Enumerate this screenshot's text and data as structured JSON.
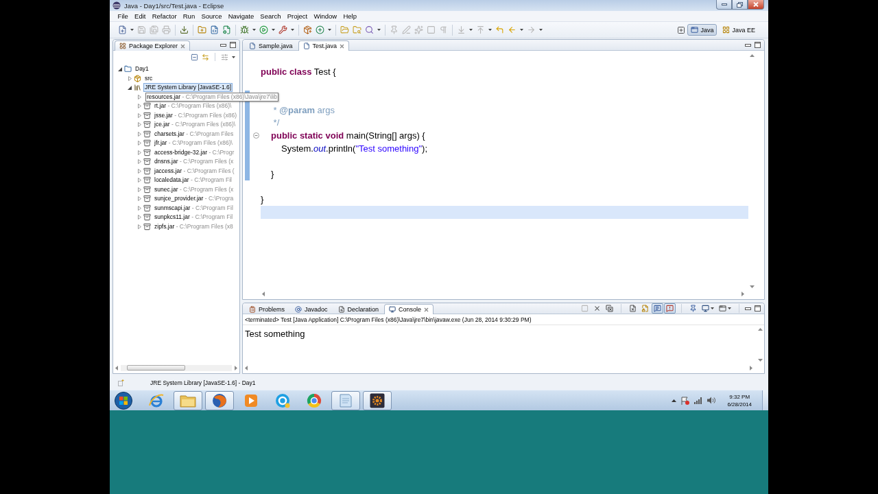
{
  "window": {
    "title": "Java - Day1/src/Test.java - Eclipse"
  },
  "menu_bar": [
    "File",
    "Edit",
    "Refactor",
    "Run",
    "Source",
    "Navigate",
    "Search",
    "Project",
    "Window",
    "Help"
  ],
  "toolbar": {
    "groups": [
      [
        {
          "disabled": false
        },
        {
          "disabled": true
        },
        {
          "disabled": true
        },
        {
          "disabled": true
        }
      ],
      [
        {
          "disabled": false
        }
      ],
      [
        {
          "disabled": false
        },
        {
          "disabled": false
        },
        {
          "disabled": false
        }
      ],
      [
        {
          "disabled": false
        },
        {
          "disabled": false
        },
        {
          "disabled": false
        }
      ],
      [
        {
          "disabled": false
        },
        {
          "disabled": false
        }
      ],
      [
        {
          "disabled": false
        },
        {
          "disabled": false
        },
        {
          "disabled": false
        }
      ],
      [
        {
          "disabled": true
        },
        {
          "disabled": true
        },
        {
          "disabled": true
        },
        {
          "disabled": true
        },
        {
          "disabled": true
        }
      ],
      [
        {
          "disabled": true
        },
        {
          "disabled": true
        },
        {
          "disabled": false
        },
        {
          "disabled": false
        },
        {
          "disabled": true
        }
      ]
    ]
  },
  "perspectives": [
    {
      "label": "Java",
      "selected": true
    },
    {
      "label": "Java EE",
      "selected": false
    }
  ],
  "package_explorer": {
    "title": "Package Explorer",
    "tree": [
      {
        "label": "Day1",
        "kind": "project",
        "expanded": true,
        "selected": false,
        "hovered": false,
        "children": [
          {
            "label": "src",
            "kind": "source_folder",
            "expanded": false,
            "selected": false,
            "hovered": false
          },
          {
            "label": "JRE System Library [JavaSE-1.6]",
            "kind": "library",
            "expanded": true,
            "selected": true,
            "hovered": false,
            "children": [
              {
                "label": "resources.jar",
                "detail": "- C:\\Program Files (x86)\\Java\\jre7\\lib",
                "kind": "jar",
                "expanded": false,
                "selected": false,
                "hovered": true
              },
              {
                "label": "rt.jar",
                "detail": "- C:\\Program Files (x86)\\",
                "kind": "jar",
                "expanded": false,
                "selected": false,
                "hovered": false
              },
              {
                "label": "jsse.jar",
                "detail": "- C:\\Program Files (x86)",
                "kind": "jar",
                "expanded": false,
                "selected": false,
                "hovered": false
              },
              {
                "label": "jce.jar",
                "detail": "- C:\\Program Files (x86)\\",
                "kind": "jar",
                "expanded": false,
                "selected": false,
                "hovered": false
              },
              {
                "label": "charsets.jar",
                "detail": "- C:\\Program Files",
                "kind": "jar",
                "expanded": false,
                "selected": false,
                "hovered": false
              },
              {
                "label": "jfr.jar",
                "detail": "- C:\\Program Files (x86)\\",
                "kind": "jar",
                "expanded": false,
                "selected": false,
                "hovered": false
              },
              {
                "label": "access-bridge-32.jar",
                "detail": "- C:\\Progr",
                "kind": "jar",
                "expanded": false,
                "selected": false,
                "hovered": false
              },
              {
                "label": "dnsns.jar",
                "detail": "- C:\\Program Files (x",
                "kind": "jar",
                "expanded": false,
                "selected": false,
                "hovered": false
              },
              {
                "label": "jaccess.jar",
                "detail": "- C:\\Program Files (",
                "kind": "jar",
                "expanded": false,
                "selected": false,
                "hovered": false
              },
              {
                "label": "localedata.jar",
                "detail": "- C:\\Program Fil",
                "kind": "jar",
                "expanded": false,
                "selected": false,
                "hovered": false
              },
              {
                "label": "sunec.jar",
                "detail": "- C:\\Program Files (x",
                "kind": "jar",
                "expanded": false,
                "selected": false,
                "hovered": false
              },
              {
                "label": "sunjce_provider.jar",
                "detail": "- C:\\Progra",
                "kind": "jar",
                "expanded": false,
                "selected": false,
                "hovered": false
              },
              {
                "label": "sunmscapi.jar",
                "detail": "- C:\\Program Fil",
                "kind": "jar",
                "expanded": false,
                "selected": false,
                "hovered": false
              },
              {
                "label": "sunpkcs11.jar",
                "detail": "- C:\\Program Fil",
                "kind": "jar",
                "expanded": false,
                "selected": false,
                "hovered": false
              },
              {
                "label": "zipfs.jar",
                "detail": "- C:\\Program Files (x8",
                "kind": "jar",
                "expanded": false,
                "selected": false,
                "hovered": false
              }
            ]
          }
        ]
      }
    ]
  },
  "editor": {
    "tabs": [
      {
        "label": "Sample.java",
        "selected": false
      },
      {
        "label": "Test.java",
        "selected": true
      }
    ],
    "lines": [
      {
        "kind": "blank",
        "in_range": false,
        "current": false,
        "fold": false
      },
      {
        "kind": "code",
        "in_range": false,
        "current": false,
        "fold": false,
        "tokens": [
          {
            "kind": "keyword",
            "text": "public class"
          },
          {
            "kind": "plain",
            "text": " Test {"
          }
        ],
        "children": [
          {
            "kind": "blank",
            "in_range": false,
            "current": false,
            "fold": false
          },
          {
            "kind": "blank",
            "in_range": true,
            "current": false,
            "fold": false
          },
          {
            "kind": "code",
            "in_range": true,
            "current": false,
            "fold": false,
            "tokens": [
              {
                "kind": "javadoc",
                "text": " * "
              },
              {
                "kind": "javadoc_tag",
                "text": "@param"
              },
              {
                "kind": "javadoc",
                "text": " args"
              }
            ]
          },
          {
            "kind": "code",
            "in_range": true,
            "current": false,
            "fold": false,
            "tokens": [
              {
                "kind": "javadoc",
                "text": " */"
              }
            ]
          },
          {
            "kind": "code",
            "in_range": true,
            "current": false,
            "fold": true,
            "tokens": [
              {
                "kind": "keyword",
                "text": "public static void"
              },
              {
                "kind": "plain",
                "text": " main(String[] args) {"
              }
            ],
            "children": [
              {
                "kind": "code",
                "in_range": true,
                "current": false,
                "fold": false,
                "tokens": [
                  {
                    "kind": "plain",
                    "text": "System."
                  },
                  {
                    "kind": "field",
                    "text": "out"
                  },
                  {
                    "kind": "plain",
                    "text": ".println("
                  },
                  {
                    "kind": "string",
                    "text": "\"Test something\""
                  },
                  {
                    "kind": "plain",
                    "text": ");"
                  }
                ]
              },
              {
                "kind": "blank",
                "in_range": true,
                "current": false,
                "fold": false
              }
            ]
          },
          {
            "kind": "code",
            "in_range": true,
            "current": false,
            "fold": false,
            "tokens": [
              {
                "kind": "plain",
                "text": "}"
              }
            ]
          },
          {
            "kind": "blank",
            "in_range": false,
            "current": false,
            "fold": false
          }
        ]
      },
      {
        "kind": "code",
        "in_range": false,
        "current": false,
        "fold": false,
        "tokens": [
          {
            "kind": "plain",
            "text": "}"
          }
        ]
      },
      {
        "kind": "blank",
        "in_range": false,
        "current": true,
        "fold": false
      }
    ]
  },
  "console": {
    "tabs": [
      {
        "label": "Problems",
        "selected": false
      },
      {
        "label": "Javadoc",
        "selected": false
      },
      {
        "label": "Declaration",
        "selected": false
      },
      {
        "label": "Console",
        "selected": true
      }
    ],
    "toolbar": [
      [
        {
          "disabled": true,
          "pressed": false
        },
        {
          "disabled": false,
          "pressed": false
        },
        {
          "disabled": false,
          "pressed": false
        }
      ],
      [
        {
          "disabled": false,
          "pressed": false
        },
        {
          "disabled": false,
          "pressed": false
        },
        {
          "disabled": false,
          "pressed": true
        },
        {
          "disabled": false,
          "pressed": true
        }
      ],
      [
        {
          "disabled": false,
          "pressed": false
        },
        {
          "disabled": false,
          "pressed": false
        },
        {
          "disabled": false,
          "pressed": false
        }
      ]
    ],
    "description": "<terminated> Test [Java Application] C:\\Program Files (x86)\\Java\\jre7\\bin\\javaw.exe (Jun 28, 2014 9:30:29 PM)",
    "output": "Test something"
  },
  "status_bar": {
    "text": "JRE System Library [JavaSE-1.6] - Day1"
  },
  "taskbar": {
    "items": [
      {
        "open": false
      },
      {
        "open": true
      },
      {
        "open": true
      },
      {
        "open": false
      },
      {
        "open": false
      },
      {
        "open": false
      },
      {
        "open": true
      },
      {
        "open": true
      }
    ],
    "clock": {
      "time": "9:32 PM",
      "date": "6/28/2014"
    }
  }
}
